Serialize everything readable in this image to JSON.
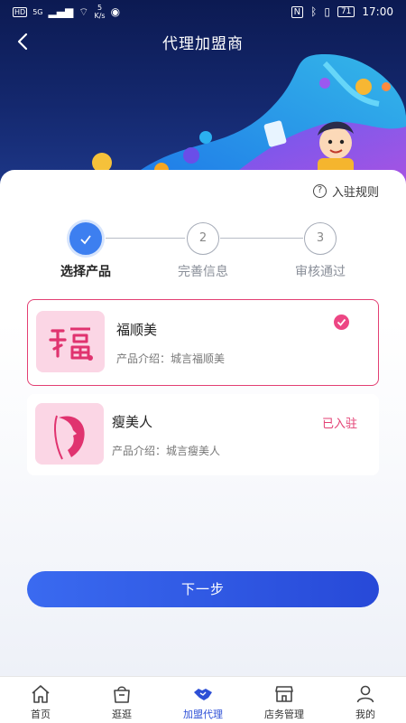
{
  "status_bar": {
    "left_network": "HD",
    "left_signal_gen": "5G",
    "speed_value": "5",
    "speed_unit": "K/s",
    "battery": "71",
    "time": "17:00"
  },
  "header": {
    "title": "代理加盟商"
  },
  "card": {
    "rules_label": "入驻规则",
    "steps": [
      {
        "index": "✓",
        "label": "选择产品",
        "state": "active"
      },
      {
        "index": "2",
        "label": "完善信息",
        "state": "idle"
      },
      {
        "index": "3",
        "label": "审核通过",
        "state": "idle"
      }
    ],
    "products": [
      {
        "name": "福顺美",
        "intro": "产品介绍：城言福顺美",
        "badge": "",
        "selected": true
      },
      {
        "name": "瘦美人",
        "intro": "产品介绍：城言瘦美人",
        "badge": "已入驻",
        "selected": false
      }
    ],
    "next_button": "下一步"
  },
  "tabs": [
    {
      "label": "首页",
      "icon": "home-icon"
    },
    {
      "label": "逛逛",
      "icon": "shopping-bag-icon"
    },
    {
      "label": "加盟代理",
      "icon": "handshake-icon",
      "active": true
    },
    {
      "label": "店务管理",
      "icon": "store-icon"
    },
    {
      "label": "我的",
      "icon": "user-icon"
    }
  ],
  "colors": {
    "primary_blue": "#3d7ff0",
    "button_blue": "#2f56e0",
    "accent_pink": "#e33f73",
    "hero_navy": "#14286e"
  }
}
